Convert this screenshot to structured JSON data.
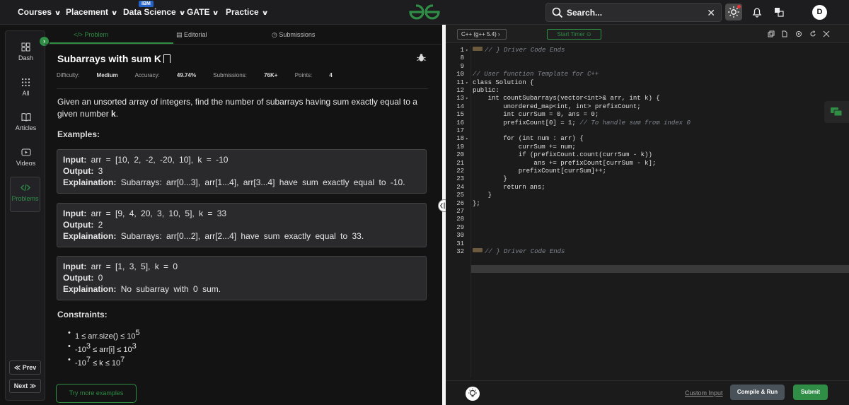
{
  "nav": {
    "items": [
      "Courses",
      "Placement",
      "Data Science",
      "GATE",
      "Practice"
    ],
    "ibm_badge": "IBM",
    "search_placeholder": "Search...",
    "avatar_letter": "D"
  },
  "sidebar": {
    "items": [
      {
        "label": "Dash",
        "icon": "dashboard-icon"
      },
      {
        "label": "All",
        "icon": "grid-icon"
      },
      {
        "label": "Articles",
        "icon": "book-icon"
      },
      {
        "label": "Videos",
        "icon": "video-icon"
      },
      {
        "label": "Problems",
        "icon": "code-icon"
      }
    ],
    "prev": "≪ Prev",
    "next": "Next ≫"
  },
  "tabs": [
    "Problem",
    "Editorial",
    "Submissions"
  ],
  "problem": {
    "title": "Subarrays with sum K",
    "difficulty_label": "Difficulty:",
    "difficulty": "Medium",
    "accuracy_label": "Accuracy:",
    "accuracy": "49.74%",
    "submissions_label": "Submissions:",
    "submissions": "76K+",
    "points_label": "Points:",
    "points": "4",
    "description_pre": "Given an unsorted array of integers, find the number of subarrays having sum exactly equal to a given number ",
    "description_k": "k",
    "description_post": ".",
    "examples_heading": "Examples:",
    "examples": [
      {
        "input": "arr = [10, 2, -2, -20, 10], k = -10",
        "output": "3",
        "explanation": "Subarrays: arr[0...3], arr[1...4], arr[3...4] have sum exactly equal to -10."
      },
      {
        "input": "arr = [9, 4, 20, 3, 10, 5], k = 33",
        "output": "2",
        "explanation": "Subarrays: arr[0...2], arr[2...4] have sum exactly equal to 33."
      },
      {
        "input": "arr = [1, 3, 5], k = 0",
        "output": "0",
        "explanation": "No subarray with 0 sum."
      }
    ],
    "input_label": "Input:",
    "output_label": "Output:",
    "explanation_label": "Explaination:",
    "constraints_heading": "Constraints:",
    "constraints": [
      {
        "text": "1 ≤ arr.size() ≤ 10",
        "sup": "5",
        "pre_sup": "",
        "tail": ""
      },
      {
        "text": "-10",
        "sup": "3",
        "pre_sup": "",
        "tail": " ≤ arr[i] ≤ 10",
        "sup2": "3"
      },
      {
        "text": "-10",
        "sup": "7",
        "pre_sup": "",
        "tail": " ≤ k ≤ 10",
        "sup2": "7"
      }
    ],
    "try_more": "Try more examples"
  },
  "editor": {
    "language": "C++ (g++ 5.4)",
    "start_timer": "Start Timer",
    "lines": [
      {
        "n": "1",
        "t": "// } Driver Code Ends",
        "fold": true,
        "cm": true
      },
      {
        "n": "8",
        "t": ""
      },
      {
        "n": "9",
        "t": ""
      },
      {
        "n": "10",
        "t": "// User function Template for C++",
        "cm": true
      },
      {
        "n": "11",
        "t": "class Solution {",
        "fold": true
      },
      {
        "n": "12",
        "t": "public:"
      },
      {
        "n": "13",
        "t": "    int countSubarrays(vector<int>& arr, int k) {",
        "fold": true
      },
      {
        "n": "14",
        "t": "        unordered_map<int, int> prefixCount;"
      },
      {
        "n": "15",
        "t": "        int currSum = 0, ans = 0;"
      },
      {
        "n": "16",
        "t": "        prefixCount[0] = 1; // To handle sum from index 0"
      },
      {
        "n": "17",
        "t": ""
      },
      {
        "n": "18",
        "t": "        for (int num : arr) {",
        "fold": true
      },
      {
        "n": "19",
        "t": "            currSum += num;"
      },
      {
        "n": "20",
        "t": "            if (prefixCount.count(currSum - k))"
      },
      {
        "n": "21",
        "t": "                ans += prefixCount[currSum - k];"
      },
      {
        "n": "22",
        "t": "            prefixCount[currSum]++;"
      },
      {
        "n": "23",
        "t": "        }"
      },
      {
        "n": "24",
        "t": "        return ans;"
      },
      {
        "n": "25",
        "t": "    }"
      },
      {
        "n": "26",
        "t": "};"
      },
      {
        "n": "27",
        "t": ""
      },
      {
        "n": "28",
        "t": ""
      },
      {
        "n": "29",
        "t": ""
      },
      {
        "n": "30",
        "t": ""
      },
      {
        "n": "31",
        "t": ""
      },
      {
        "n": "32",
        "t": "// } Driver Code Ends",
        "cm": true
      }
    ],
    "custom_input": "Custom Input",
    "compile_run": "Compile & Run",
    "submit": "Submit"
  },
  "colors": {
    "brand_green": "#2f8d46",
    "background": "#131313",
    "panel": "#1c1c1e",
    "compile_btn": "#4a5259"
  }
}
